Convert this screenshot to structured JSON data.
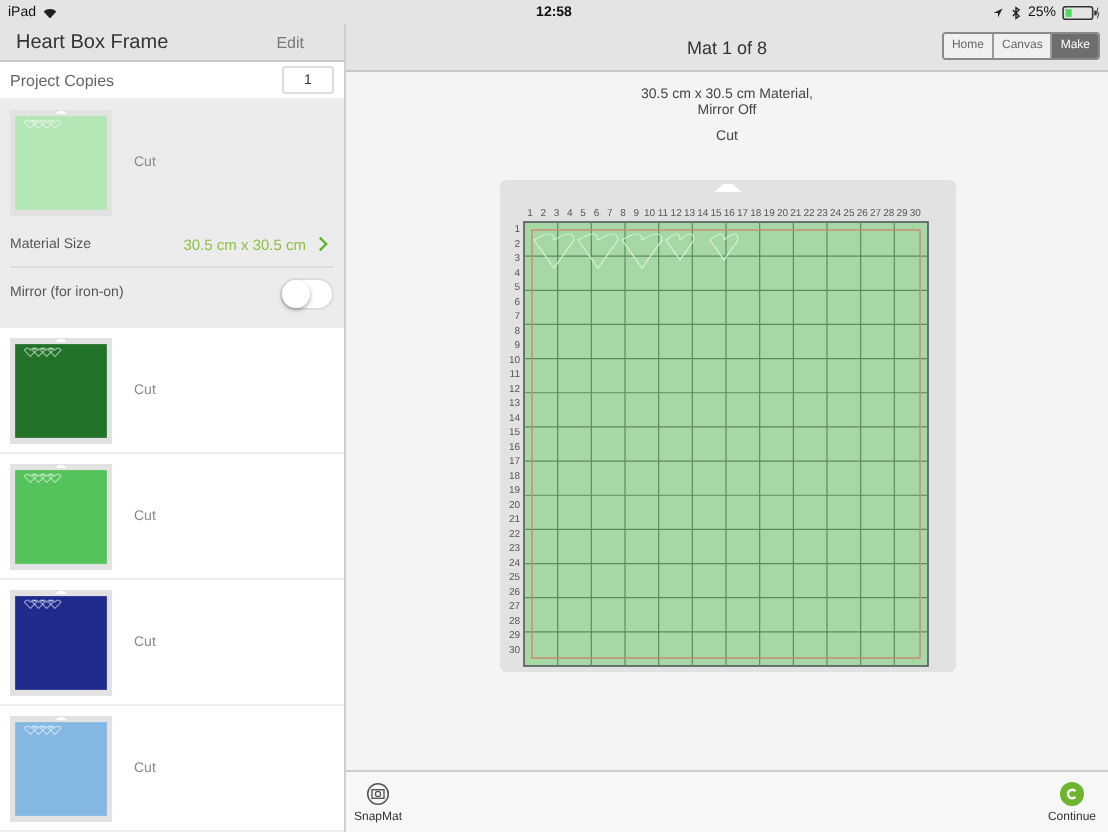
{
  "status_bar": {
    "device": "iPad",
    "time": "12:58",
    "battery": "25%"
  },
  "sidebar": {
    "title": "Heart Box Frame",
    "edit": "Edit",
    "copies_label": "Project Copies",
    "copies_value": "1",
    "mats": [
      {
        "color": "#b3e6b5",
        "label": "Cut",
        "selected": true,
        "material_label": "Material Size",
        "material_value": "30.5 cm x 30.5 cm",
        "mirror_label": "Mirror (for iron-on)",
        "mirror_on": false
      },
      {
        "color": "#22722a",
        "label": "Cut",
        "selected": false
      },
      {
        "color": "#55c35b",
        "label": "Cut",
        "selected": false
      },
      {
        "color": "#1f2a8c",
        "label": "Cut",
        "selected": false
      },
      {
        "color": "#84b8e3",
        "label": "Cut",
        "selected": false
      }
    ]
  },
  "main": {
    "title": "Mat 1 of 8",
    "tabs": [
      {
        "label": "Home",
        "selected": false
      },
      {
        "label": "Canvas",
        "selected": false
      },
      {
        "label": "Make",
        "selected": true
      }
    ],
    "info_lines": [
      "30.5 cm x 30.5 cm Material,",
      "Mirror Off"
    ],
    "operation": "Cut",
    "mat": {
      "color": "#a6d8a6",
      "top_ruler": [
        "1",
        "2",
        "3",
        "4",
        "5",
        "6",
        "7",
        "8",
        "9",
        "10",
        "11",
        "12",
        "13",
        "14",
        "15",
        "16",
        "17",
        "18",
        "19",
        "20",
        "21",
        "22",
        "23",
        "24",
        "25",
        "26",
        "27",
        "28",
        "29",
        "30"
      ],
      "side_ruler": [
        "1",
        "2",
        "3",
        "4",
        "5",
        "6",
        "7",
        "8",
        "9",
        "10",
        "11",
        "12",
        "13",
        "14",
        "15",
        "16",
        "17",
        "18",
        "19",
        "20",
        "21",
        "22",
        "23",
        "24",
        "25",
        "26",
        "27",
        "28",
        "29",
        "30"
      ]
    }
  },
  "bottom_bar": {
    "left": "SnapMat",
    "right": "Continue"
  }
}
